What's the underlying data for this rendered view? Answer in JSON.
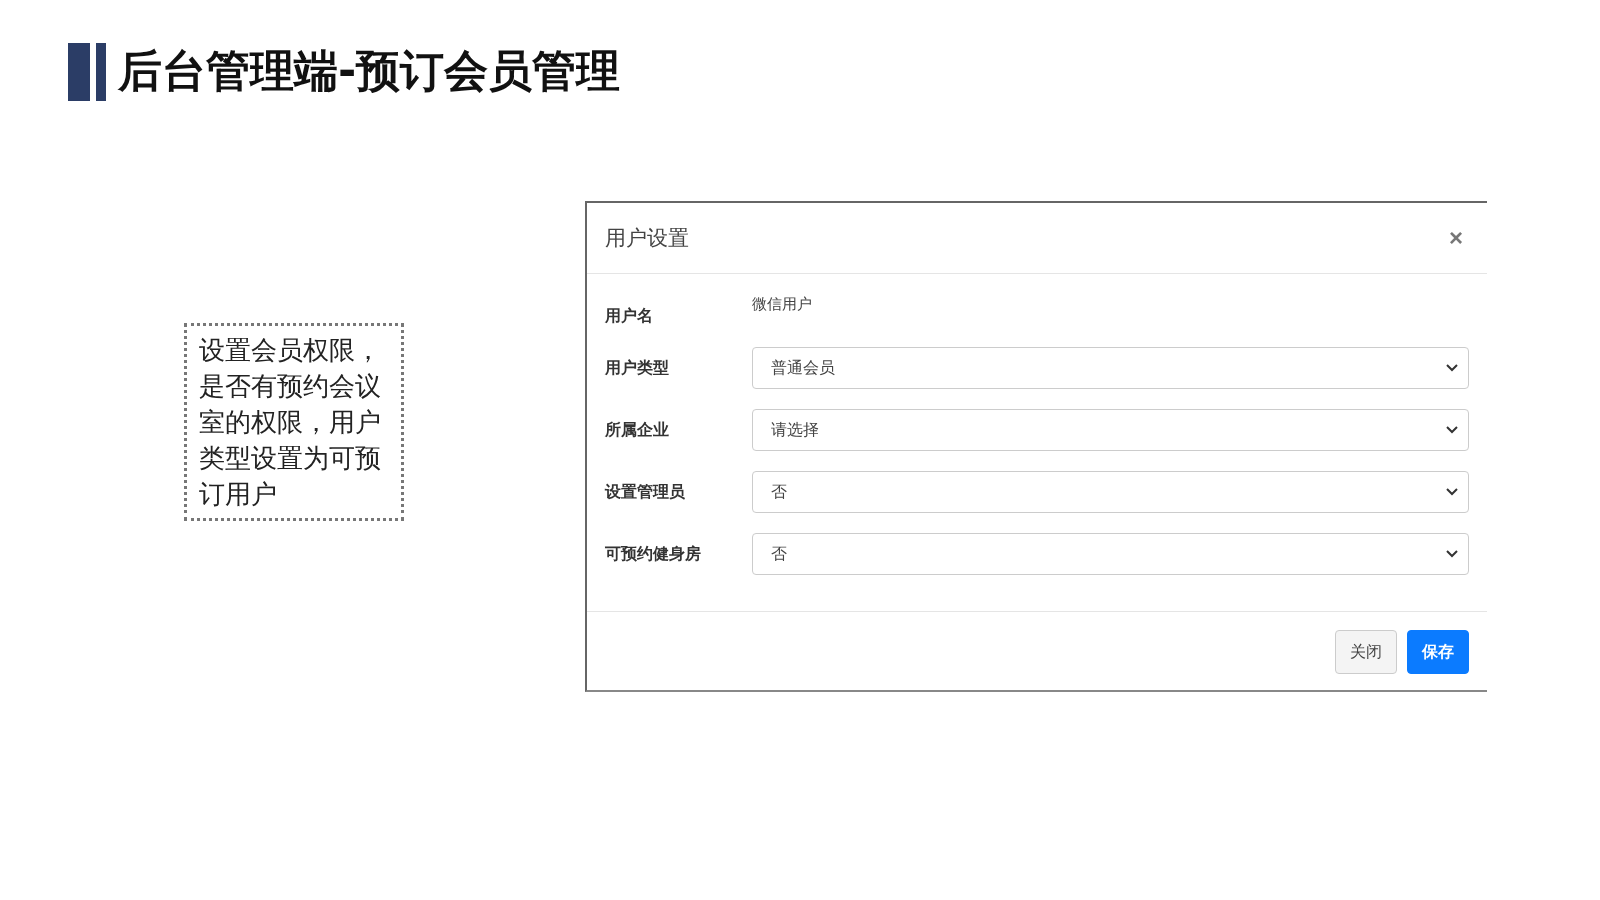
{
  "slide_title": "后台管理端-预订会员管理",
  "note": "设置会员权限，是否有预约会议室的权限，用户类型设置为可预订用户",
  "dialog": {
    "title": "用户设置",
    "close": "×",
    "fields": [
      {
        "kind": "text",
        "label": "用户名",
        "value": "微信用户"
      },
      {
        "kind": "select",
        "label": "用户类型",
        "value": "普通会员"
      },
      {
        "kind": "select",
        "label": "所属企业",
        "value": "请选择"
      },
      {
        "kind": "select",
        "label": "设置管理员",
        "value": "否"
      },
      {
        "kind": "select",
        "label": "可预约健身房",
        "value": "否"
      }
    ],
    "buttons": [
      {
        "label": "关闭",
        "primary": false
      },
      {
        "label": "保存",
        "primary": true
      }
    ]
  }
}
